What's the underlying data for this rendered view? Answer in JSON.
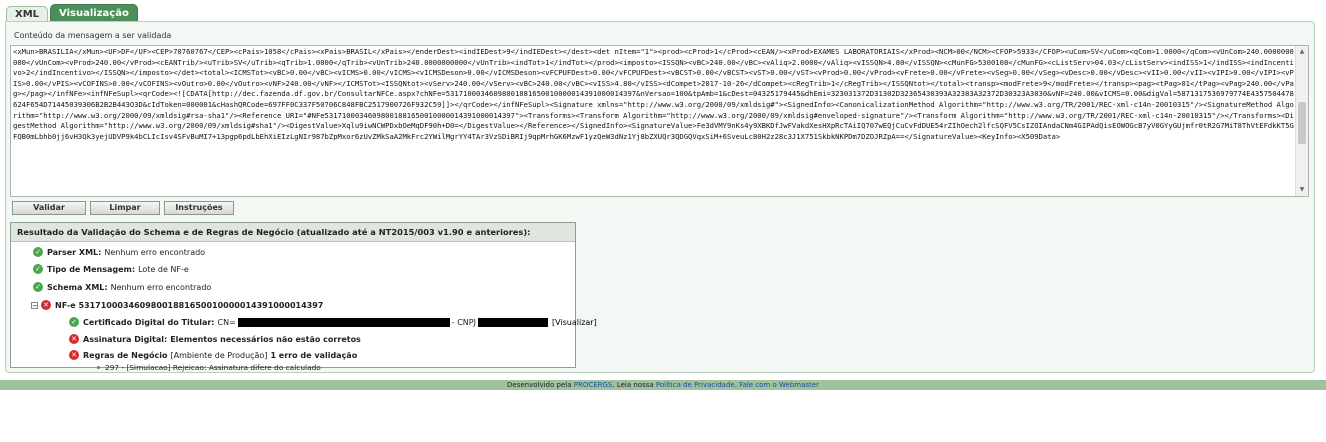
{
  "tabs": [
    {
      "label": "XML"
    },
    {
      "label": "Visualização"
    }
  ],
  "content_label": "Conteúdo da mensagem a ser validada",
  "xml_content": "<xMun>BRASILIA</xMun><UF>DF</UF><CEP>70760767</CEP><cPais>1058</cPais><xPais>BRASIL</xPais></enderDest><indIEDest>9</indIEDest></dest><det nItem=\"1\"><prod><cProd>1</cProd><cEAN/><xProd>EXAMES LABORATORIAIS</xProd><NCM>00</NCM><CFOP>5933</CFOP><uCom>SV</uCom><qCom>1.0000</qCom><vUnCom>240.0000000000</vUnCom><vProd>240.00</vProd><cEANTrib/><uTrib>SV</uTrib><qTrib>1.0000</qTrib><vUnTrib>240.0000000000</vUnTrib><indTot>1</indTot></prod><imposto><ISSQN><vBC>240.00</vBC><vAliq>2.0000</vAliq><vISSQN>4.80</vISSQN><cMunFG>5300108</cMunFG><cListServ>04.03</cListServ><indISS>1</indISS><indIncentivo>2</indIncentivo></ISSQN></imposto></det><total><ICMSTot><vBC>0.00</vBC><vICMS>0.00</vICMS><vICMSDeson>0.00</vICMSDeson><vFCPUFDest>0.00</vFCPUFDest><vBCST>0.00</vBCST><vST>0.00</vST><vProd>0.00</vProd><vFrete>0.00</vFrete><vSeg>0.00</vSeg><vDesc>0.00</vDesc><vII>0.00</vII><vIPI>0.00</vIPI><vPIS>0.00</vPIS><vCOFINS>0.00</vCOFINS><vOutro>0.00</vOutro><vNF>240.00</vNF></ICMSTot><ISSQNtot><vServ>240.00</vServ><vBC>240.00</vBC><vISS>4.80</vISS><dCompet>2017-10-26</dCompet><cRegTrib>1</cRegTrib></ISSQNtot></total><transp><modFrete>9</modFrete></transp><pag><tPag>01</tPag><vPag>240.00</vPag></pag></infNFe><infNFeSupl><qrCode><![CDATA[http://dec.fazenda.df.gov.br/ConsultarNFCe.aspx?chNFe=53171000346098001881650010000014391000014397&nVersao=100&tpAmb=1&cDest=04325179445&dhEmi=323031372D31302D32365430393A32383A32372D30323A3030&vNF=240.00&vICMS=0.00&digVal=5871317536979774E4357504478624F654D71445039306B2B2B443O3D&cIdToken=000001&cHashQRCode=697FF0C337F50706C848FBC2517900726F932C59]]></qrCode></infNFeSupl><Signature xmlns=\"http://www.w3.org/2000/09/xmldsig#\"><SignedInfo><CanonicalizationMethod Algorithm=\"http://www.w3.org/TR/2001/REC-xml-c14n-20010315\"/><SignatureMethod Algorithm=\"http://www.w3.org/2000/09/xmldsig#rsa-sha1\"/><Reference URI=\"#NFe53171000346098001881650010000014391000014397\"><Transforms><Transform Algorithm=\"http://www.w3.org/2000/09/xmldsig#enveloped-signature\"/><Transform Algorithm=\"http://www.w3.org/TR/2001/REC-xml-c14n-20010315\"/></Transforms><DigestMethod Algorithm=\"http://www.w3.org/2000/09/xmldsig#sha1\"/><DigestValue>Xqlu9iwNCWPDxbOeMqDF90h+D0=</DigestValue></Reference></SignedInfo><SignatureValue>Fe3dVMY9nKs4y9XBKDfJwFVakdXesHXpRcTAiIQ707wEQjCuCvFdDUE54rZIhOech2lfcSQFV5CsIZOIAndaCNm4GIPAdQisEOWOGcB7yV0GYyGUjmfr0tR2G7MiT8ThVtEFdkKT5GFQB0mLbhb0jj6vH3Qk3yejUDVP9k4bCLIcIsv4SFvBuMI7+13pgp6pdLbEhXiEIzLgNIr987bZpMxor6zUvZMkSaA2MkFrc2YWilMgrYY4TAr3VzSDiBRIj9qpMrhGK6MzwF1yzQeW3dNz1Yj8bZXUQr3QDGQVqxSiM+6SveuLc80H2z28c3J1X751SkbkNKPDm7DZOJRZpA==</SignatureValue><KeyInfo><X509Data>",
  "buttons": {
    "validar": "Validar",
    "limpar": "Limpar",
    "instrucoes": "Instruções"
  },
  "result": {
    "title": "Resultado da Validação do Schema e de Regras de Negócio (atualizado até a NT2015/003 v1.90 e anteriores):",
    "parser_label": "Parser XML:",
    "parser_value": "Nenhum erro encontrado",
    "tipo_label": "Tipo de Mensagem:",
    "tipo_value": "Lote de NF-e",
    "schema_label": "Schema XML:",
    "schema_value": "Nenhum erro encontrado",
    "tree_toggle": "−",
    "nfe_label": "NF-e 53171000346098001881650010000014391000014397",
    "cert_label": "Certificado Digital do Titular:",
    "cert_cn": "CN=",
    "cert_cnpj": "- CNPJ",
    "visualizar": "[Visualizar]",
    "assinatura_label": "Assinatura Digital:",
    "assinatura_value": "Elementos necessários não estão corretos",
    "regras_label": "Regras de Negócio",
    "regras_env": "[Ambiente de Produção]",
    "regras_count": "1 erro de validação",
    "rejeicao": "297 - [Simulacao] Rejeicao: Assinatura difere do calculado"
  },
  "icons": {
    "ok": "check-circle-icon",
    "error": "x-circle-icon"
  },
  "colors": {
    "tab_active": "#4b8e5a",
    "ok": "#4aa84a",
    "error": "#d62b2b",
    "footer": "#9dc29d"
  },
  "footer": {
    "prefix": "Desenvolvido pela",
    "procergs": "PROCERGS",
    "middle": ". Leia nossa",
    "privacy": "Política de Privacidade",
    "dot": ".",
    "contact": "Fale com o Webmaster"
  }
}
